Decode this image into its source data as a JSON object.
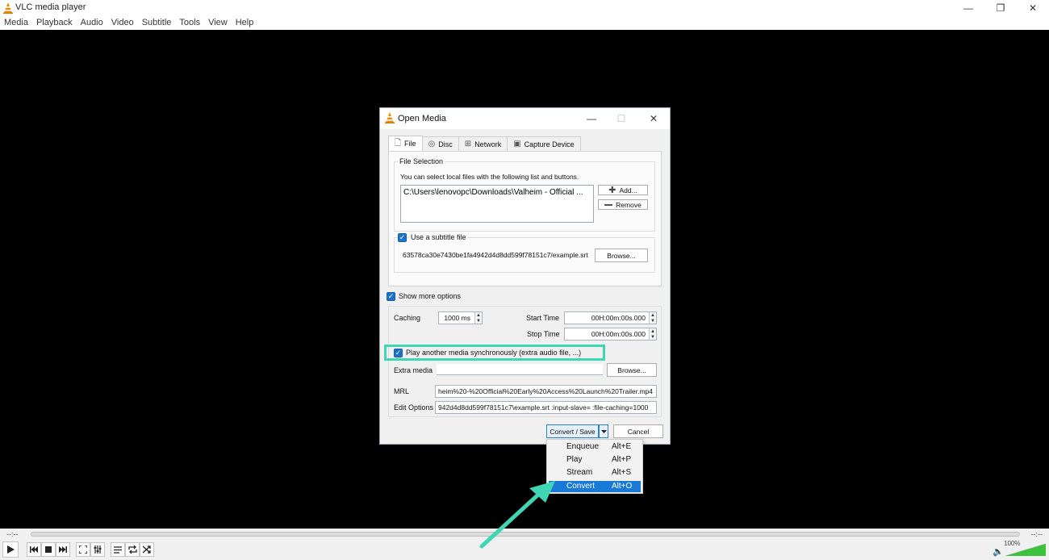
{
  "window": {
    "title": "VLC media player",
    "controls": {
      "minimize": "—",
      "maximize": "❐",
      "close": "✕"
    }
  },
  "menubar": [
    "Media",
    "Playback",
    "Audio",
    "Video",
    "Subtitle",
    "Tools",
    "View",
    "Help"
  ],
  "player": {
    "time_elapsed": "--:--",
    "time_total": "--:--",
    "volume": "100%"
  },
  "dialog": {
    "title": "Open Media",
    "tabs": [
      {
        "label": "File",
        "icon": "file-icon"
      },
      {
        "label": "Disc",
        "icon": "disc-icon"
      },
      {
        "label": "Network",
        "icon": "network-icon"
      },
      {
        "label": "Capture Device",
        "icon": "capture-device-icon"
      }
    ],
    "file_selection": {
      "group_label": "File Selection",
      "info": "You can select local files with the following list and buttons.",
      "files": [
        "C:\\Users\\lenovopc\\Downloads\\Valheim - Official ..."
      ],
      "add_label": "Add...",
      "remove_label": "Remove"
    },
    "subtitle": {
      "checkbox_label": "Use a subtitle file",
      "checked": true,
      "path": "63578ca30e7430be1fa4942d4d8dd599f78151c7/example.srt",
      "browse_label": "Browse..."
    },
    "show_more_options": {
      "label": "Show more options",
      "checked": true
    },
    "options": {
      "caching_label": "Caching",
      "caching_value": "1000 ms",
      "start_time_label": "Start Time",
      "start_time_value": "00H:00m:00s.000",
      "stop_time_label": "Stop Time",
      "stop_time_value": "00H:00m:00s.000",
      "play_another_label": "Play another media synchronously (extra audio file, ...)",
      "play_another_checked": true,
      "extra_media_label": "Extra media",
      "extra_media_value": "",
      "extra_browse_label": "Browse...",
      "mrl_label": "MRL",
      "mrl_value": "heim%20-%20Official%20Early%20Access%20Launch%20Trailer.mp4",
      "edit_options_label": "Edit Options",
      "edit_options_value": "942d4d8dd599f78151c7\\example.srt :input-slave= :file-caching=1000"
    },
    "convert_save_label": "Convert / Save",
    "cancel_label": "Cancel"
  },
  "dropdown_menu": [
    {
      "label": "Enqueue",
      "shortcut": "Alt+E",
      "selected": false
    },
    {
      "label": "Play",
      "shortcut": "Alt+P",
      "selected": false
    },
    {
      "label": "Stream",
      "shortcut": "Alt+S",
      "selected": false
    },
    {
      "label": "Convert",
      "shortcut": "Alt+O",
      "selected": true
    }
  ],
  "colors": {
    "highlight": "#3fd6b4",
    "selection": "#1979d6",
    "checkbox": "#1a73c9",
    "vlc_orange": "#f08a00"
  }
}
